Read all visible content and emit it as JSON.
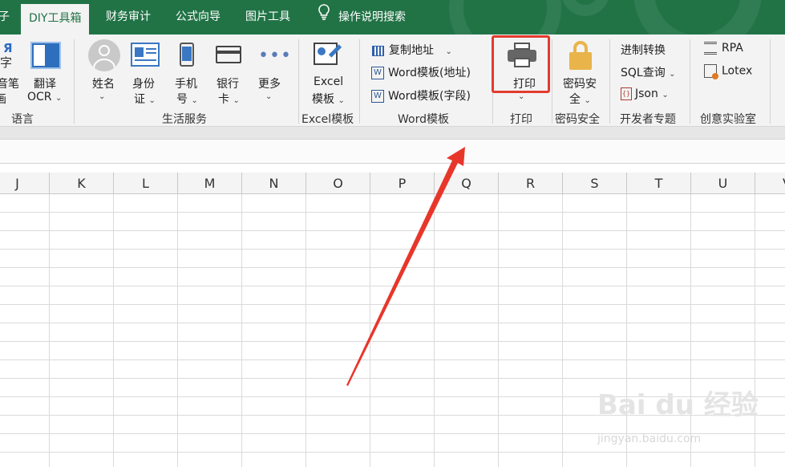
{
  "tabs": [
    {
      "label": "子",
      "active": false
    },
    {
      "label": "DIY工具箱",
      "active": true
    },
    {
      "label": "财务审计",
      "active": false
    },
    {
      "label": "公式向导",
      "active": false
    },
    {
      "label": "图片工具",
      "active": false
    }
  ],
  "tellme": "操作说明搜索",
  "ribbon": {
    "language": {
      "pinyin_top": "字",
      "pinyin_label_1": "音笔",
      "pinyin_label_2": "画",
      "translate_1": "翻译",
      "translate_2": "OCR",
      "group": "语言"
    },
    "life": {
      "name_1": "姓名",
      "id_1": "身份",
      "id_2": "证",
      "phone_1": "手机",
      "phone_2": "号",
      "bank_1": "银行",
      "bank_2": "卡",
      "more": "更多",
      "group": "生活服务"
    },
    "excel_tpl": {
      "label_1": "Excel",
      "label_2": "模板",
      "group": "Excel模板"
    },
    "word_tpl": {
      "copy_addr": "复制地址",
      "word_addr": "Word模板(地址)",
      "word_field": "Word模板(字段)",
      "group": "Word模板"
    },
    "print": {
      "label": "打印",
      "group": "打印"
    },
    "password": {
      "label_1": "密码安",
      "label_2": "全",
      "group": "密码安全"
    },
    "dev": {
      "base_convert": "进制转换",
      "sql_query": "SQL查询",
      "json": "Json",
      "group": "开发者专题"
    },
    "lab": {
      "rpa": "RPA",
      "lotex": "Lotex",
      "group": "创意实验室"
    }
  },
  "columns": [
    "J",
    "K",
    "L",
    "M",
    "N",
    "O",
    "P",
    "Q",
    "R",
    "S",
    "T",
    "U",
    "V"
  ],
  "watermark": {
    "logo": "Bai du 经验",
    "url": "jingyan.baidu.com"
  },
  "colors": {
    "brand_green": "#217346",
    "annotation_red": "#e33b2f"
  }
}
